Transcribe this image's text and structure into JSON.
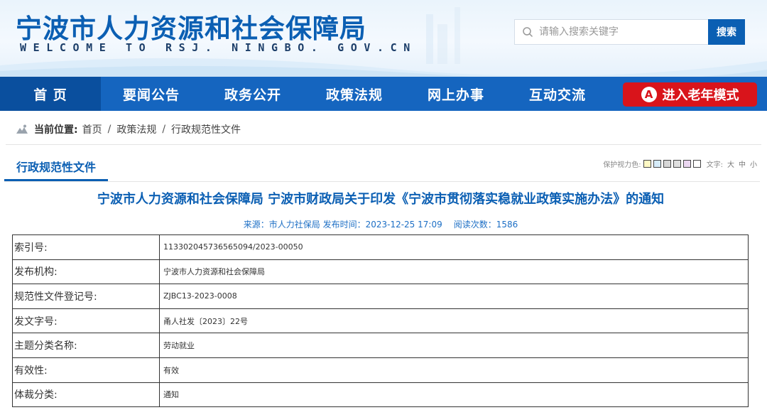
{
  "header": {
    "title": "宁波市人力资源和社会保障局",
    "subtitle": "WELCOME TO RSJ. NINGBO. GOV.CN",
    "search": {
      "placeholder": "请输入搜索关键字",
      "button_label": "搜索"
    }
  },
  "nav": {
    "items": [
      {
        "label": "首 页",
        "active": true
      },
      {
        "label": "要闻公告"
      },
      {
        "label": "政务公开"
      },
      {
        "label": "政策法规"
      },
      {
        "label": "网上办事"
      },
      {
        "label": "互动交流"
      }
    ],
    "elder_mode": {
      "icon": "A",
      "label": "进入老年模式"
    }
  },
  "breadcrumb": {
    "label": "当前位置:",
    "items": [
      "首页",
      "政策法规",
      "行政规范性文件"
    ],
    "separator": "/"
  },
  "section": {
    "tab_label": "行政规范性文件",
    "eye_care_label": "保护视力色:",
    "eye_care_colors": [
      "#fff9c4",
      "#d6ecfa",
      "#d7d7d7",
      "#dfdfdf",
      "#ebd7f1",
      "#ffffff"
    ],
    "font_label": "文字:",
    "font_sizes": [
      "大",
      "中",
      "小"
    ]
  },
  "article": {
    "title": "宁波市人力资源和社会保障局 宁波市财政局关于印发《宁波市贯彻落实稳就业政策实施办法》的通知",
    "source": "来源：市人力社保局",
    "publish_time": "发布时间：2023-12-25 17:09",
    "reads": "阅读次数：1586"
  },
  "info_table": [
    {
      "key": "索引号:",
      "value": "113302045736565094/2023-00050"
    },
    {
      "key": "发布机构:",
      "value": "宁波市人力资源和社会保障局"
    },
    {
      "key": "规范性文件登记号:",
      "value": "ZJBC13-2023-0008"
    },
    {
      "key": "发文字号:",
      "value": "甬人社发〔2023〕22号"
    },
    {
      "key": "主题分类名称:",
      "value": "劳动就业"
    },
    {
      "key": "有效性:",
      "value": "有效"
    },
    {
      "key": "体裁分类:",
      "value": "通知"
    }
  ],
  "colors": {
    "brand_blue": "#0b5fb3",
    "nav_blue": "#1565bf",
    "elder_red": "#d9141b"
  }
}
